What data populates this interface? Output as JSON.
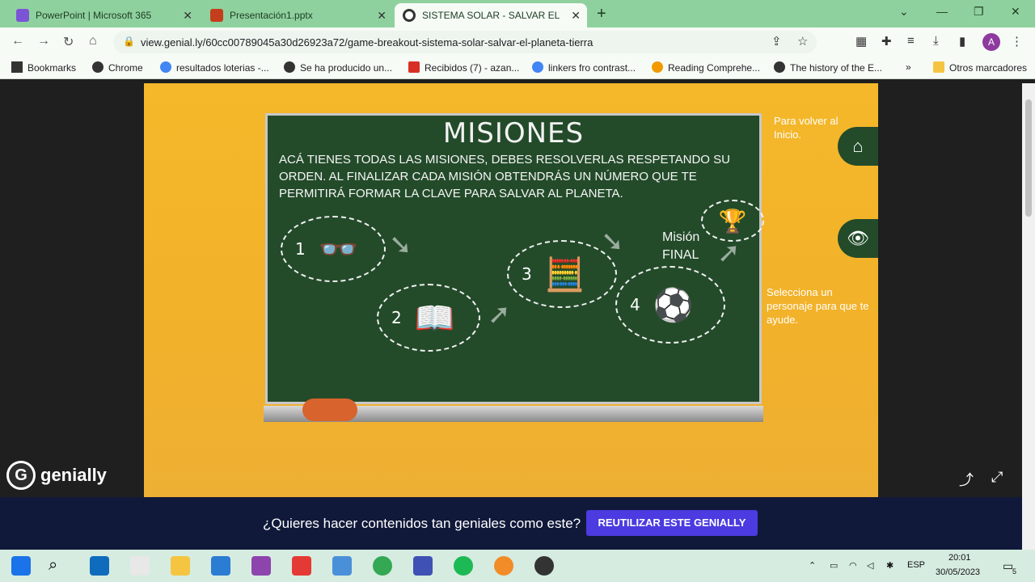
{
  "browser": {
    "tabs": [
      {
        "label": "PowerPoint | Microsoft 365",
        "color": "#7b54d6"
      },
      {
        "label": "Presentación1.pptx",
        "color": "#c43e1c"
      },
      {
        "label": "SISTEMA SOLAR - SALVAR EL PLÁ",
        "color": "#202124"
      }
    ],
    "url": "view.genial.ly/60cc00789045a30d26923a72/game-breakout-sistema-solar-salvar-el-planeta-tierra",
    "profile_initial": "A",
    "bookmarks": [
      {
        "label": "Bookmarks",
        "icon": "star-icon"
      },
      {
        "label": "Chrome",
        "icon": "chrome-icon"
      },
      {
        "label": "resultados loterias -...",
        "icon": "google-icon"
      },
      {
        "label": "Se ha producido un...",
        "icon": "globe-icon"
      },
      {
        "label": "Recibidos (7) - azan...",
        "icon": "gmail-icon"
      },
      {
        "label": "linkers fro contrast...",
        "icon": "google-icon"
      },
      {
        "label": "Reading Comprehe...",
        "icon": "search-icon"
      },
      {
        "label": "The history of the E...",
        "icon": "globe-icon"
      },
      {
        "label": "Otros marcadores",
        "icon": "folder-icon"
      }
    ]
  },
  "board": {
    "title": "MISIONES",
    "text": "ACÁ  TIENES TODAS LAS MISIONES, DEBES RESOLVERLAS RESPETANDO SU ORDEN. AL FINALIZAR CADA MISIÓN OBTENDRÁS UN NÚMERO QUE TE PERMITIRÁ FORMAR LA CLAVE PARA SALVAR AL PLANETA.",
    "missions": [
      {
        "number": "1",
        "icon": "glasses-icon"
      },
      {
        "number": "2",
        "icon": "book-icon"
      },
      {
        "number": "3",
        "icon": "calculator-icon"
      },
      {
        "number": "4",
        "icon": "soccer-ball-icon"
      }
    ],
    "final_label_1": "Misión",
    "final_label_2": "FINAL"
  },
  "side": {
    "home_hint": "Para volver al Inicio.",
    "character_hint": "Selecciona un personaje para que te ayude."
  },
  "brand": "genially",
  "banner": {
    "question": "¿Quieres hacer contenidos tan geniales como este?",
    "button": "REUTILIZAR ESTE GENIALLY"
  },
  "system": {
    "lang": "ESP",
    "time": "20:01",
    "date": "30/05/2023",
    "notifications": "5"
  }
}
